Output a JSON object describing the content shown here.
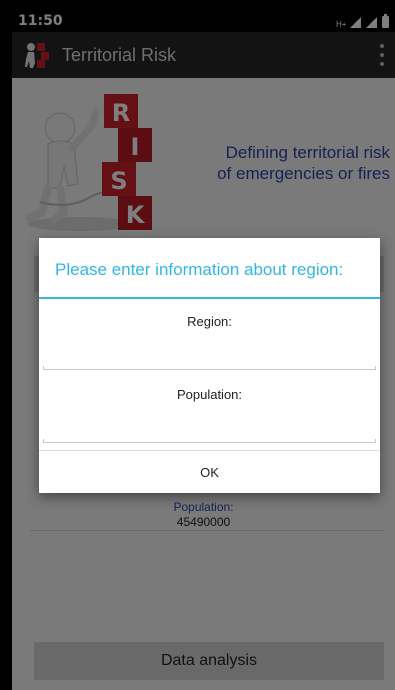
{
  "status_bar": {
    "time": "11:50",
    "network_label": "H+",
    "icons": [
      "network-type-icon",
      "signal-icon",
      "signal-icon",
      "battery-icon"
    ]
  },
  "action_bar": {
    "title": "Territorial Risk",
    "icons": [
      "app-logo-icon",
      "overflow-menu-icon"
    ]
  },
  "content": {
    "image_icon": "risk-figure-icon",
    "risk_letters": [
      "R",
      "I",
      "S",
      "K"
    ],
    "subtitle_line1": "Defining territorial risk",
    "subtitle_line2": "of emergencies or fires",
    "population_label": "Population:",
    "population_value": "45490000",
    "data_analysis_label": "Data analysis"
  },
  "dialog": {
    "title": "Please enter information about region:",
    "region_label": "Region:",
    "region_value": "",
    "population_label": "Population:",
    "population_value": "",
    "ok_label": "OK"
  },
  "colors": {
    "accent": "#33b5e5",
    "subtitle": "#2c44a8",
    "action_bar": "#262626",
    "risk_block": "#c8202a"
  }
}
